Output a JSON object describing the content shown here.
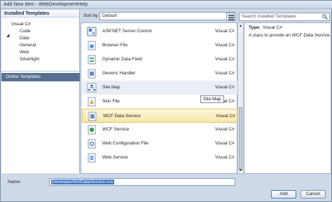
{
  "window": {
    "title": "Add New Item - WebDevelopmentHelp"
  },
  "left": {
    "header": "Installed Templates",
    "tree": {
      "root": "Visual C#",
      "children": [
        "Code",
        "Data",
        "General",
        "Web",
        "Silverlight"
      ]
    },
    "online": "Online Templates"
  },
  "toolbar": {
    "sort_label": "Sort by:",
    "sort_value": "Default",
    "search_placeholder": "Search Installed Templates"
  },
  "templates": [
    {
      "name": "ASP.NET Server Control",
      "lang": "Visual C#",
      "icon": "server-control-icon"
    },
    {
      "name": "Browser File",
      "lang": "Visual C#",
      "icon": "browser-file-icon"
    },
    {
      "name": "Dynamic Data Field",
      "lang": "Visual C#",
      "icon": "data-field-icon"
    },
    {
      "name": "Generic Handler",
      "lang": "Visual C#",
      "icon": "generic-handler-icon"
    },
    {
      "name": "Site Map",
      "lang": "Visual C#",
      "icon": "site-map-icon"
    },
    {
      "name": "Skin File",
      "lang": "Visual C#",
      "icon": "skin-file-icon"
    },
    {
      "name": "WCF Data Service",
      "lang": "Visual C#",
      "icon": "wcf-data-service-icon"
    },
    {
      "name": "WCF Service",
      "lang": "Visual C#",
      "icon": "wcf-service-icon"
    },
    {
      "name": "Web Configuration File",
      "lang": "Visual C#",
      "icon": "web-config-icon"
    },
    {
      "name": "Web Service",
      "lang": "Visual C#",
      "icon": "web-service-icon"
    }
  ],
  "tooltip": "Site Map",
  "info": {
    "type_label": "Type:",
    "type_value": "Visual C#",
    "description": "A class to provide an WCF Data Service."
  },
  "bottom": {
    "name_label": "Name:",
    "name_value": "DeveloperWcfDataService.svc",
    "add_label": "Add",
    "cancel_label": "Cancel"
  },
  "colors": {
    "selection": "#f7e6a6",
    "online_bg": "#56708f",
    "accent": "#3d7fc6"
  }
}
